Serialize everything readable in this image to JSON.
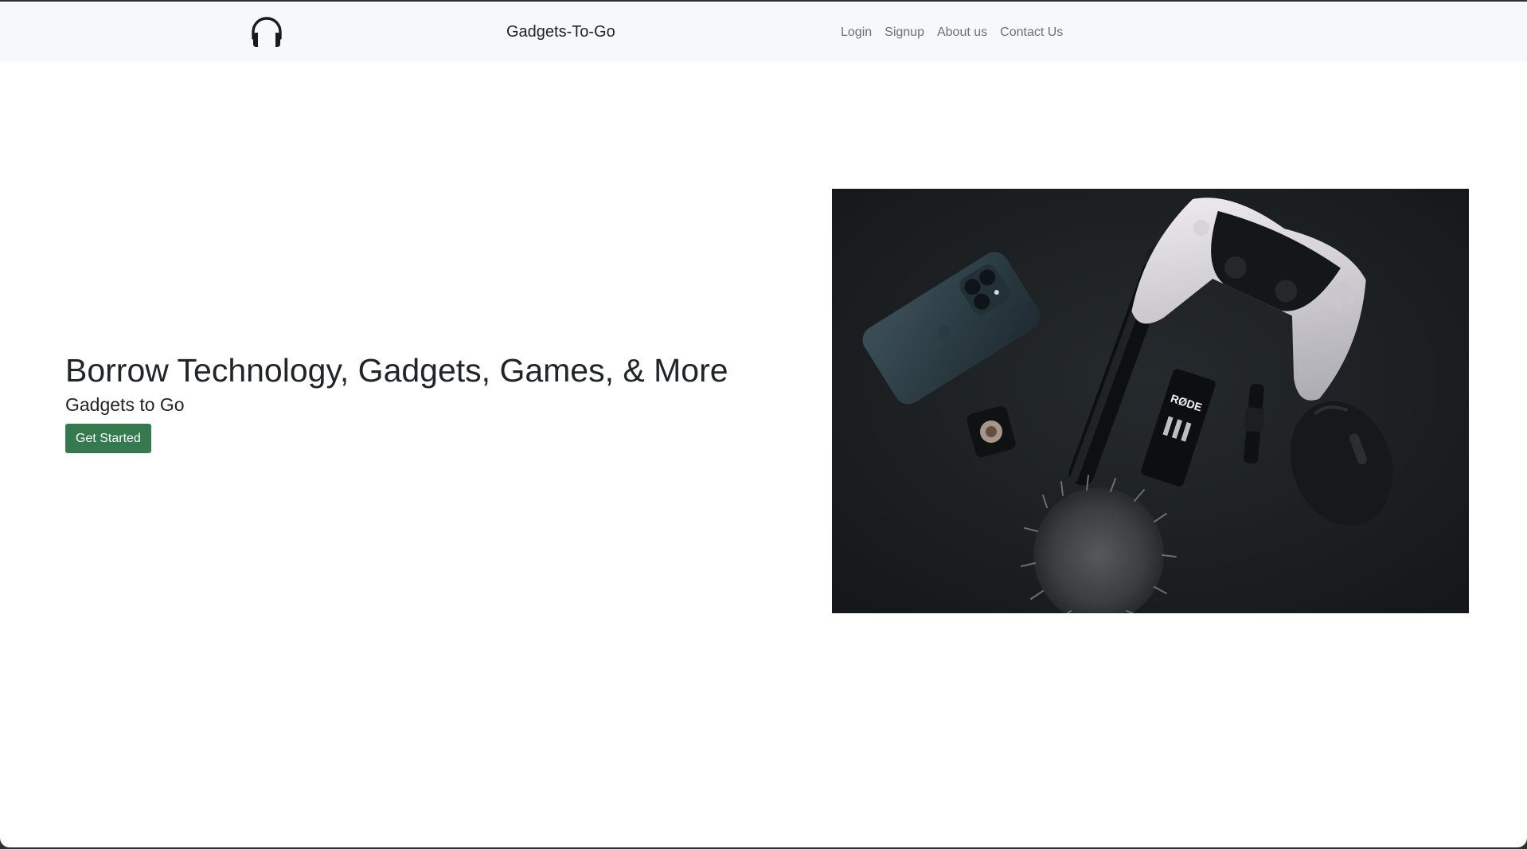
{
  "navbar": {
    "logo_icon": "headphones-icon",
    "brand": "Gadgets-To-Go",
    "links": [
      {
        "label": "Login"
      },
      {
        "label": "Signup"
      },
      {
        "label": "About us"
      },
      {
        "label": "Contact Us"
      }
    ]
  },
  "hero": {
    "title": "Borrow Technology, Gadgets, Games, & More",
    "subtitle": "Gadgets to Go",
    "cta_label": "Get Started",
    "image": {
      "mic_brand": "RØDE"
    }
  },
  "colors": {
    "navbar_bg": "#f7f8f9",
    "primary_button": "#357a4f",
    "text": "#212529",
    "nav_link": "#6b7075"
  }
}
